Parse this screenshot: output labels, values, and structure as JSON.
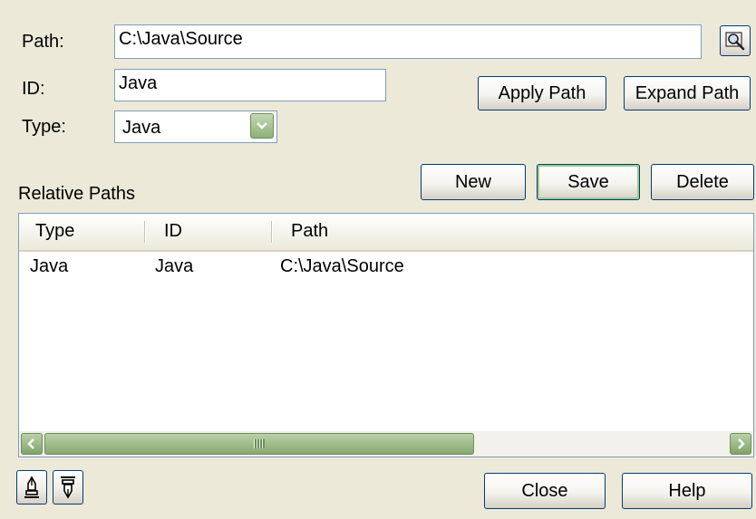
{
  "fields": {
    "path_label": "Path:",
    "path_value": "C:\\Java\\Source",
    "id_label": "ID:",
    "id_value": "Java",
    "type_label": "Type:",
    "type_value": "Java"
  },
  "buttons": {
    "apply_path": "Apply Path",
    "expand_path": "Expand Path",
    "new": "New",
    "save": "Save",
    "delete": "Delete",
    "close": "Close",
    "help": "Help"
  },
  "relative_paths": {
    "label": "Relative Paths",
    "columns": [
      "Type",
      "ID",
      "Path"
    ],
    "rows": [
      {
        "type": "Java",
        "id": "Java",
        "path": "C:\\Java\\Source"
      }
    ]
  },
  "icons": {
    "browse": "folder-search-icon",
    "export": "export-pen-icon",
    "import": "import-pen-icon",
    "scroll_left": "chevron-left-icon",
    "scroll_right": "chevron-right-icon",
    "dropdown": "chevron-down-icon"
  },
  "colors": {
    "dialog_bg": "#ECE9D8",
    "input_border": "#7F9DB9",
    "button_border": "#003C74",
    "scroll_green": "#87A973"
  }
}
